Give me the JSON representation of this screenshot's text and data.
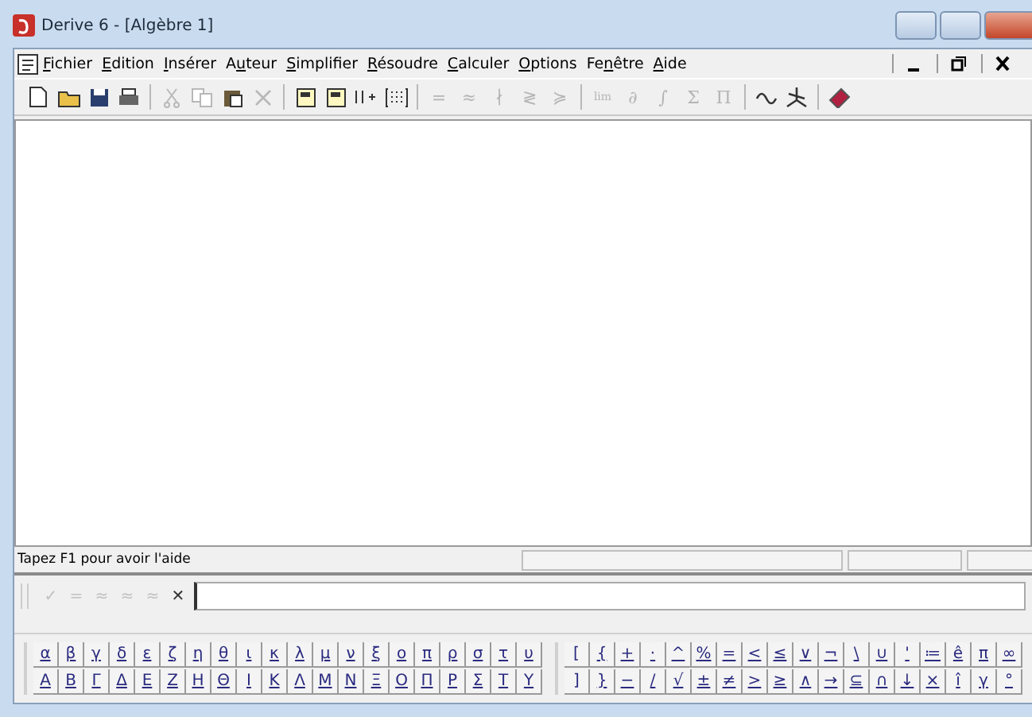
{
  "window": {
    "title": "Derive 6 - [Algèbre 1]"
  },
  "menu": [
    {
      "key": "F",
      "after": "ichier"
    },
    {
      "key": "E",
      "after": "dition"
    },
    {
      "key": "I",
      "after": "nsérer"
    },
    {
      "before": "A",
      "key": "u",
      "after": "teur"
    },
    {
      "key": "S",
      "after": "implifier"
    },
    {
      "key": "R",
      "after": "ésoudre"
    },
    {
      "key": "C",
      "after": "alculer"
    },
    {
      "key": "O",
      "after": "ptions"
    },
    {
      "before": "Fe",
      "key": "n",
      "after": "être"
    },
    {
      "key": "A",
      "after": "ide"
    }
  ],
  "toolbar": [
    {
      "kind": "new",
      "disabled": false
    },
    {
      "kind": "open",
      "disabled": false
    },
    {
      "kind": "save",
      "disabled": false
    },
    {
      "kind": "print",
      "disabled": false
    },
    {
      "kind": "sep"
    },
    {
      "kind": "cut",
      "disabled": true
    },
    {
      "kind": "copy",
      "disabled": true
    },
    {
      "kind": "paste",
      "disabled": false
    },
    {
      "kind": "delete",
      "disabled": true
    },
    {
      "kind": "sep"
    },
    {
      "kind": "note",
      "disabled": false
    },
    {
      "kind": "note",
      "disabled": false
    },
    {
      "kind": "vector",
      "disabled": false
    },
    {
      "kind": "matrix",
      "disabled": false
    },
    {
      "kind": "sep"
    },
    {
      "kind": "glyph",
      "glyph": "=",
      "disabled": true
    },
    {
      "kind": "glyph",
      "glyph": "≈",
      "disabled": true
    },
    {
      "kind": "glyph",
      "glyph": "∤",
      "disabled": true
    },
    {
      "kind": "glyph",
      "glyph": "≷",
      "disabled": true
    },
    {
      "kind": "glyph",
      "glyph": "≽",
      "disabled": true
    },
    {
      "kind": "sep"
    },
    {
      "kind": "glyph",
      "glyph": "lim",
      "disabled": true
    },
    {
      "kind": "glyph",
      "glyph": "∂",
      "disabled": true
    },
    {
      "kind": "glyph",
      "glyph": "∫",
      "disabled": true
    },
    {
      "kind": "glyph",
      "glyph": "Σ",
      "disabled": true
    },
    {
      "kind": "glyph",
      "glyph": "Π",
      "disabled": true
    },
    {
      "kind": "sep"
    },
    {
      "kind": "plot2d",
      "disabled": false
    },
    {
      "kind": "plot3d",
      "disabled": false
    },
    {
      "kind": "sep"
    },
    {
      "kind": "book",
      "disabled": false
    }
  ],
  "status_bar": {
    "text": "Tapez F1 pour avoir l'aide"
  },
  "entry_bar": {
    "buttons": [
      {
        "glyph": "✓",
        "disabled": true
      },
      {
        "glyph": "=",
        "disabled": true
      },
      {
        "glyph": "≈",
        "disabled": true
      },
      {
        "glyph": "≈",
        "disabled": true
      },
      {
        "glyph": "≈",
        "disabled": true
      },
      {
        "glyph": "✕",
        "disabled": false
      }
    ]
  },
  "greek_keys": [
    [
      "α",
      "β",
      "γ",
      "δ",
      "ε",
      "ζ",
      "η",
      "θ",
      "ι",
      "κ",
      "λ",
      "μ",
      "ν",
      "ξ",
      "ο",
      "π",
      "ρ",
      "σ",
      "τ",
      "υ"
    ],
    [
      "Α",
      "Β",
      "Γ",
      "Δ",
      "Ε",
      "Ζ",
      "Η",
      "Θ",
      "Ι",
      "Κ",
      "Λ",
      "Μ",
      "Ν",
      "Ξ",
      "Ο",
      "Π",
      "Ρ",
      "Σ",
      "Τ",
      "Υ"
    ]
  ],
  "math_keys": [
    [
      "[",
      "{",
      "+",
      "·",
      "^",
      "%",
      "=",
      "<",
      "≤",
      "∨",
      "¬",
      "\\",
      "∪",
      "'",
      "≔",
      "ê",
      "π",
      "∞"
    ],
    [
      "]",
      "}",
      "−",
      "/",
      "√",
      "±",
      "≠",
      ">",
      "≥",
      "∧",
      "→",
      "⊆",
      "∩",
      "↓",
      "×",
      "î",
      "γ",
      "°"
    ]
  ]
}
